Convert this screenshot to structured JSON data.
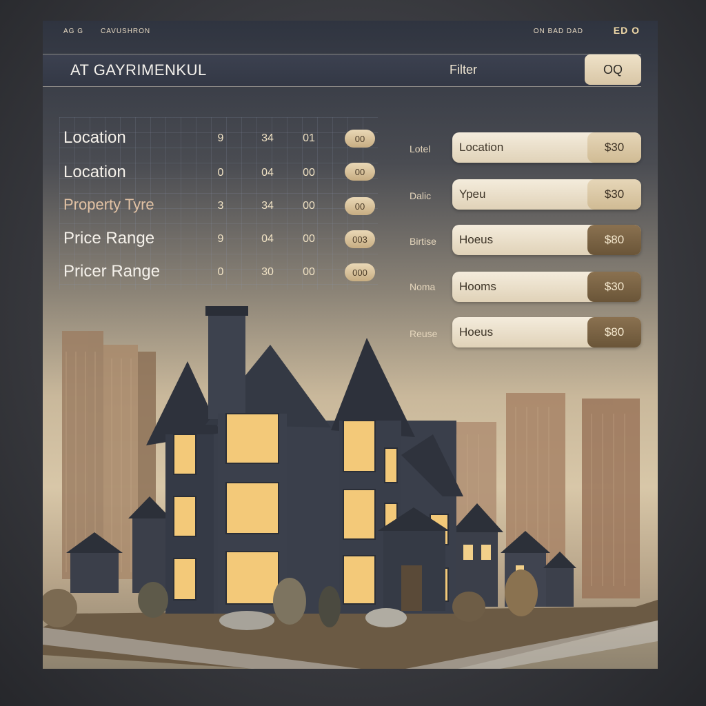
{
  "topbar": {
    "left1": "AG G",
    "left2": "CAVUSHRON",
    "right1": "ON BAD DAD",
    "right2": "ED O"
  },
  "header": {
    "brand": "AT GAYRIMENKUL",
    "filter_label": "Filter",
    "search_label": "OQ"
  },
  "table": {
    "column_headers": [
      "",
      "",
      "",
      ""
    ],
    "rows": [
      {
        "label": "Location",
        "c1": "9",
        "c2": "34",
        "c3": "01",
        "c4": "00"
      },
      {
        "label": "Location",
        "c1": "0",
        "c2": "04",
        "c3": "00",
        "c4": "00"
      },
      {
        "label": "Property Tyre",
        "c1": "3",
        "c2": "34",
        "c3": "00",
        "c4": "00"
      },
      {
        "label": "Price Range",
        "c1": "9",
        "c2": "04",
        "c3": "00",
        "c4": "003"
      },
      {
        "label": "Pricer Range",
        "c1": "0",
        "c2": "30",
        "c3": "00",
        "c4": "000"
      }
    ]
  },
  "filters": [
    {
      "side_label": "Lotel",
      "field": "Location",
      "value": "$30",
      "dark": false
    },
    {
      "side_label": "Dalic",
      "field": "Ypeu",
      "value": "$30",
      "dark": false
    },
    {
      "side_label": "Birtise",
      "field": "Hoeus",
      "value": "$80",
      "dark": true
    },
    {
      "side_label": "Noma",
      "field": "Hooms",
      "value": "$30",
      "dark": true
    },
    {
      "side_label": "Reuse",
      "field": "Hoeus",
      "value": "$80",
      "dark": true
    }
  ],
  "colors": {
    "accent": "#d0bb94",
    "dark_button": "#6a5538",
    "header": "#333845"
  },
  "icons": {
    "search": "search-icon"
  }
}
